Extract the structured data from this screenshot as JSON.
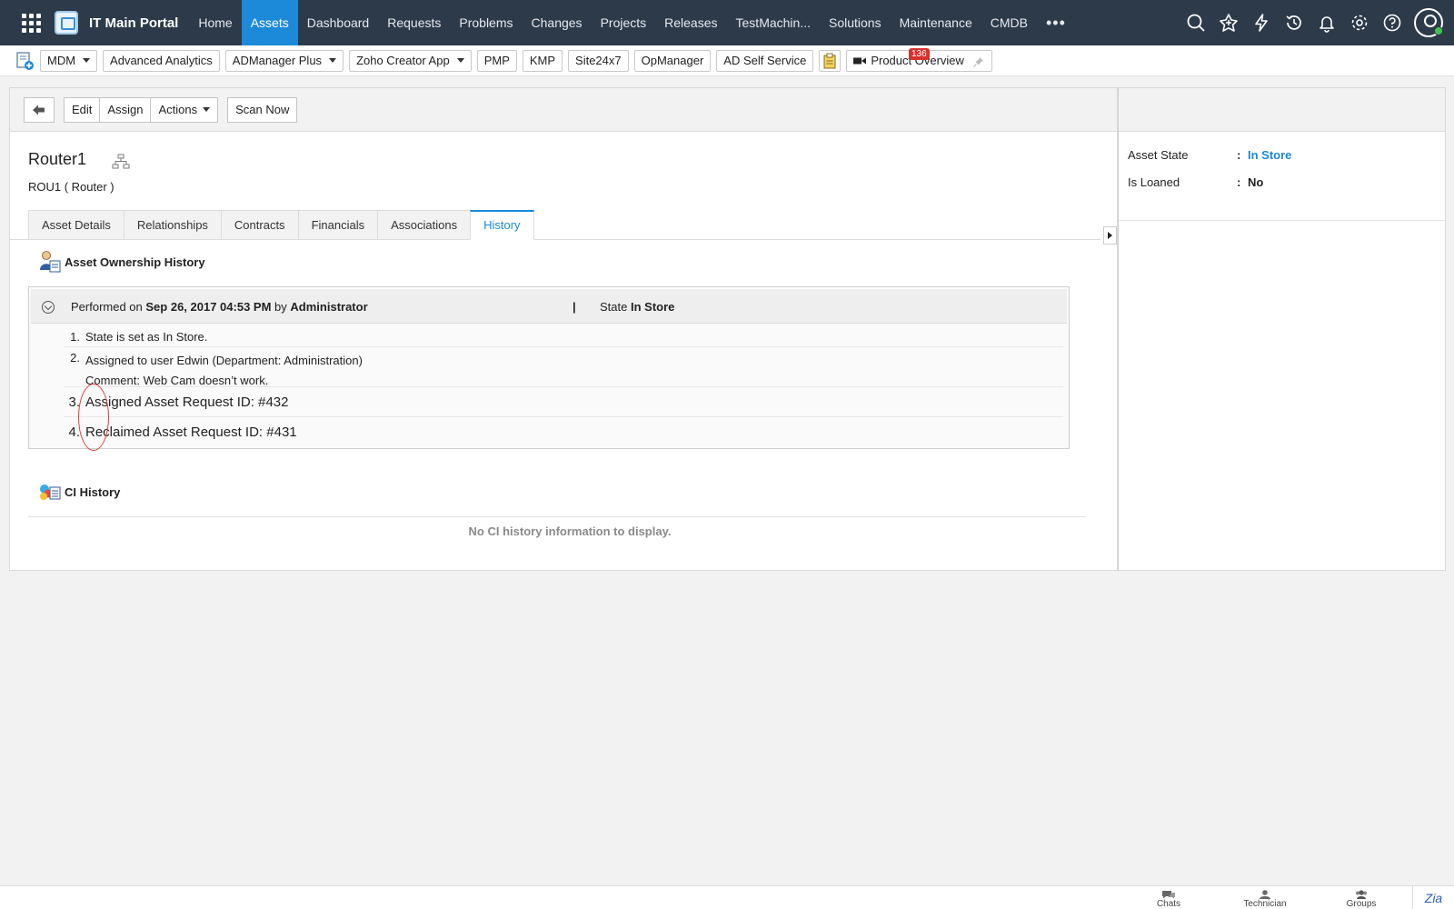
{
  "nav": {
    "brand": "IT Main Portal",
    "tabs": [
      {
        "label": "Home"
      },
      {
        "label": "Assets"
      },
      {
        "label": "Dashboard"
      },
      {
        "label": "Requests"
      },
      {
        "label": "Problems"
      },
      {
        "label": "Changes"
      },
      {
        "label": "Projects"
      },
      {
        "label": "Releases"
      },
      {
        "label": "TestMachin..."
      },
      {
        "label": "Solutions"
      },
      {
        "label": "Maintenance"
      },
      {
        "label": "CMDB"
      }
    ],
    "more": "•••",
    "active_tab": "Assets",
    "accent": "#1c8ad8"
  },
  "toolbar": {
    "items": [
      {
        "label": "MDM",
        "dropdown": true
      },
      {
        "label": "Advanced Analytics"
      },
      {
        "label": "ADManager Plus",
        "dropdown": true
      },
      {
        "label": "Zoho Creator App",
        "dropdown": true
      },
      {
        "label": "PMP"
      },
      {
        "label": "KMP"
      },
      {
        "label": "Site24x7"
      },
      {
        "label": "OpManager"
      },
      {
        "label": "AD Self Service"
      }
    ],
    "product_overview": "Product Overview",
    "badge_count": "136"
  },
  "actions": {
    "edit": "Edit",
    "assign": "Assign",
    "actions": "Actions",
    "scan_now": "Scan Now"
  },
  "asset": {
    "name": "Router1",
    "subtitle": "ROU1 ( Router )"
  },
  "tabs": [
    {
      "label": "Asset Details"
    },
    {
      "label": "Relationships"
    },
    {
      "label": "Contracts"
    },
    {
      "label": "Financials"
    },
    {
      "label": "Associations"
    },
    {
      "label": "History"
    }
  ],
  "ownership": {
    "heading": "Asset Ownership History",
    "performed_prefix": "Performed on",
    "date": "Sep 26, 2017 04:53 PM",
    "by_word": "by",
    "by": "Administrator",
    "separator": "|",
    "state_prefix": "State",
    "state": "In Store",
    "entries": [
      {
        "num": "1.",
        "text": "State is set as In Store."
      },
      {
        "num": "2.",
        "text": "Assigned to user Edwin (Department: Administration)",
        "comment": "Comment: Web Cam doesn’t work."
      },
      {
        "num": "3.",
        "text": "Assigned Asset Request ID: #432"
      },
      {
        "num": "4.",
        "text": "Reclaimed Asset Request ID: #431"
      }
    ]
  },
  "ci": {
    "heading": "CI History",
    "empty": "No CI history information to display."
  },
  "side": {
    "state_label": "Asset State",
    "state_value": "In Store",
    "loaned_label": "Is Loaned",
    "loaned_value": "No",
    "colon": ":"
  },
  "footer": {
    "chats": "Chats",
    "technician": "Technician",
    "groups": "Groups",
    "zia": "Zia"
  }
}
